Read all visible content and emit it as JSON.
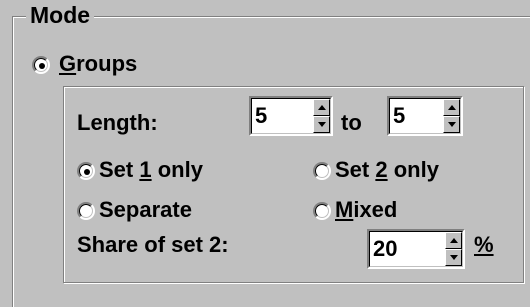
{
  "mode": {
    "title": "Mode",
    "groups_radio": {
      "prefix": "",
      "accel": "G",
      "rest": "roups",
      "selected": true
    }
  },
  "groups": {
    "length_label": "Length:",
    "length_from": "5",
    "to_label": "to",
    "length_to": "5",
    "set1": {
      "prefix": "Set ",
      "accel": "1",
      "rest": " only",
      "selected": true
    },
    "set2": {
      "prefix": "Set ",
      "accel": "2",
      "rest": " only",
      "selected": false
    },
    "separate": {
      "label": "Separate",
      "selected": false
    },
    "mixed": {
      "prefix": "",
      "accel": "M",
      "rest": "ixed",
      "selected": false
    },
    "share_label": "Share of set 2:",
    "share_value": "20",
    "percent": "%"
  }
}
